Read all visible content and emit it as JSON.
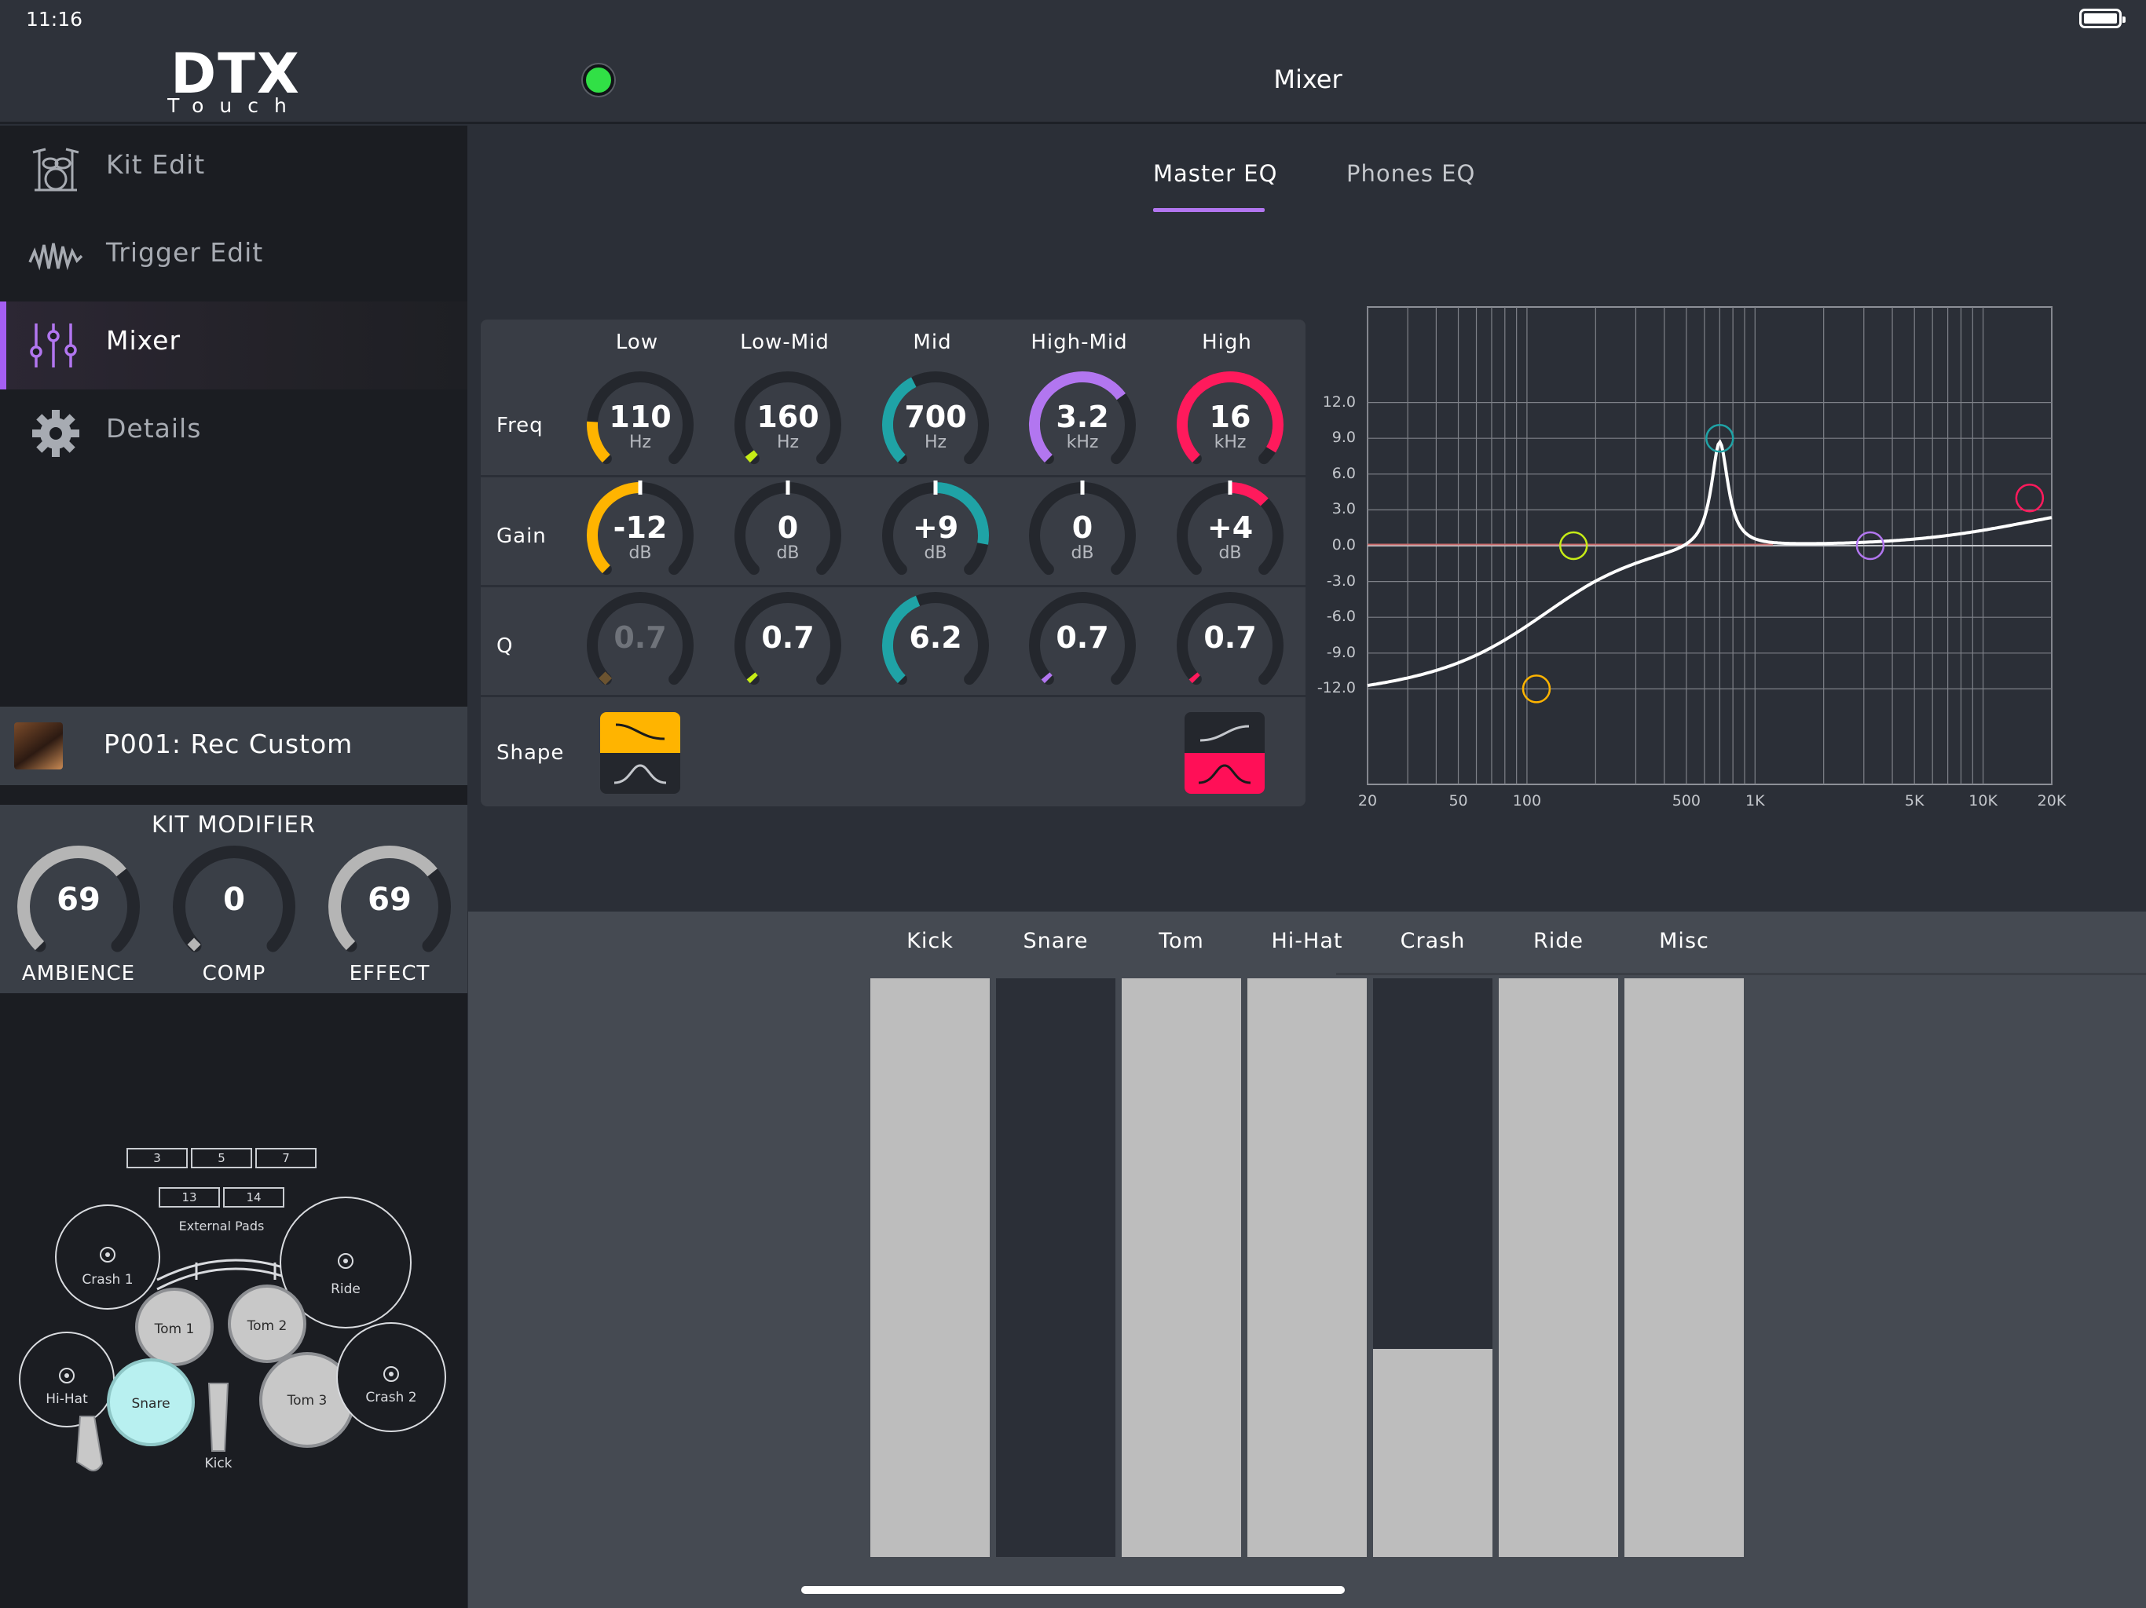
{
  "status": {
    "time": "11:16"
  },
  "header": {
    "title": "Mixer",
    "logo_main": "DTX",
    "logo_sub": "Touch"
  },
  "sidebar": {
    "items": [
      {
        "label": "Kit Edit",
        "icon": "drum-kit-icon"
      },
      {
        "label": "Trigger Edit",
        "icon": "waveform-icon"
      },
      {
        "label": "Mixer",
        "icon": "sliders-icon",
        "active": true
      },
      {
        "label": "Details",
        "icon": "gear-icon"
      }
    ],
    "accent": "#a55ff2"
  },
  "kit": {
    "name": "P001: Rec Custom"
  },
  "kit_modifier": {
    "title": "KIT MODIFIER",
    "knobs": [
      {
        "label": "AMBIENCE",
        "value": "69",
        "level": 0.69
      },
      {
        "label": "COMP",
        "value": "0",
        "level": 0
      },
      {
        "label": "EFFECT",
        "value": "69",
        "level": 0.69
      }
    ]
  },
  "drum_map": {
    "pads_top": [
      "3",
      "5",
      "7"
    ],
    "pads_mid": [
      "13",
      "14"
    ],
    "external_label": "External Pads",
    "crash1": "Crash 1",
    "ride": "Ride",
    "tom1": "Tom 1",
    "tom2": "Tom 2",
    "hihat": "Hi-Hat",
    "snare": "Snare",
    "tom3": "Tom 3",
    "crash2": "Crash 2",
    "kick": "Kick"
  },
  "eq": {
    "tabs": [
      {
        "label": "Master EQ",
        "active": true
      },
      {
        "label": "Phones EQ",
        "active": false
      }
    ],
    "row_labels": {
      "freq": "Freq",
      "gain": "Gain",
      "q": "Q",
      "shape": "Shape"
    },
    "bands": [
      {
        "name": "Low",
        "color": "#ffb400",
        "freq": {
          "value": "110",
          "unit": "Hz",
          "level": 0.18
        },
        "gain": {
          "value": "-12",
          "unit": "dB",
          "level": 0.0
        },
        "q": {
          "value": "0.7",
          "level": 0.0,
          "disabled": true
        }
      },
      {
        "name": "Low-Mid",
        "color": "#c6ec16",
        "freq": {
          "value": "160",
          "unit": "Hz",
          "level": 0.03
        },
        "gain": {
          "value": "0",
          "unit": "dB",
          "level": 0.5
        },
        "q": {
          "value": "0.7",
          "level": 0.02
        }
      },
      {
        "name": "Mid",
        "color": "#1fa3a6",
        "freq": {
          "value": "700",
          "unit": "Hz",
          "level": 0.4
        },
        "gain": {
          "value": "+9",
          "unit": "dB",
          "level": 0.87
        },
        "q": {
          "value": "6.2",
          "level": 0.42
        }
      },
      {
        "name": "High-Mid",
        "color": "#b276f0",
        "freq": {
          "value": "3.2",
          "unit": "kHz",
          "level": 0.7
        },
        "gain": {
          "value": "0",
          "unit": "dB",
          "level": 0.5
        },
        "q": {
          "value": "0.7",
          "level": 0.02
        }
      },
      {
        "name": "High",
        "color": "#ff1a5c",
        "freq": {
          "value": "16",
          "unit": "kHz",
          "level": 0.95
        },
        "gain": {
          "value": "+4",
          "unit": "dB",
          "level": 0.67
        },
        "q": {
          "value": "0.7",
          "level": 0.02
        }
      }
    ],
    "graph": {
      "y_ticks": [
        "12.0",
        "9.0",
        "6.0",
        "3.0",
        "0.0",
        "-3.0",
        "-6.0",
        "-9.0",
        "-12.0"
      ],
      "x_ticks": [
        "20",
        "50",
        "100",
        "500",
        "1K",
        "5K",
        "10K",
        "20K"
      ],
      "x_values": [
        20,
        50,
        100,
        500,
        1000,
        5000,
        10000,
        20000
      ],
      "x_range": [
        20,
        20000
      ],
      "y_range": [
        -20,
        20
      ],
      "band_points": [
        {
          "band": "Low",
          "freq": 110,
          "gain": -12
        },
        {
          "band": "Low-Mid",
          "freq": 160,
          "gain": 0
        },
        {
          "band": "Mid",
          "freq": 700,
          "gain": 9
        },
        {
          "band": "High-Mid",
          "freq": 3200,
          "gain": 0
        },
        {
          "band": "High",
          "freq": 16000,
          "gain": 4
        }
      ]
    }
  },
  "faders": [
    {
      "label": "Kick",
      "level": 1.0
    },
    {
      "label": "Snare",
      "level": 0.0
    },
    {
      "label": "Tom",
      "level": 1.0
    },
    {
      "label": "Hi-Hat",
      "level": 1.0
    },
    {
      "label": "Crash",
      "level": 0.36
    },
    {
      "label": "Ride",
      "level": 1.0
    },
    {
      "label": "Misc",
      "level": 1.0
    }
  ]
}
